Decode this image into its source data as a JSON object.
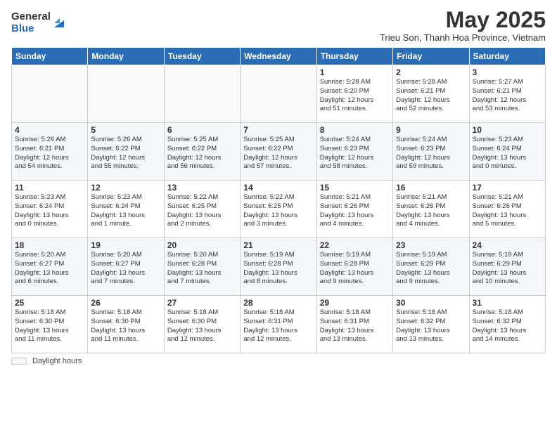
{
  "logo": {
    "general": "General",
    "blue": "Blue"
  },
  "title": "May 2025",
  "location": "Trieu Son, Thanh Hoa Province, Vietnam",
  "headers": [
    "Sunday",
    "Monday",
    "Tuesday",
    "Wednesday",
    "Thursday",
    "Friday",
    "Saturday"
  ],
  "weeks": [
    [
      {
        "day": "",
        "info": ""
      },
      {
        "day": "",
        "info": ""
      },
      {
        "day": "",
        "info": ""
      },
      {
        "day": "",
        "info": ""
      },
      {
        "day": "1",
        "info": "Sunrise: 5:28 AM\nSunset: 6:20 PM\nDaylight: 12 hours\nand 51 minutes."
      },
      {
        "day": "2",
        "info": "Sunrise: 5:28 AM\nSunset: 6:21 PM\nDaylight: 12 hours\nand 52 minutes."
      },
      {
        "day": "3",
        "info": "Sunrise: 5:27 AM\nSunset: 6:21 PM\nDaylight: 12 hours\nand 53 minutes."
      }
    ],
    [
      {
        "day": "4",
        "info": "Sunrise: 5:26 AM\nSunset: 6:21 PM\nDaylight: 12 hours\nand 54 minutes."
      },
      {
        "day": "5",
        "info": "Sunrise: 5:26 AM\nSunset: 6:22 PM\nDaylight: 12 hours\nand 55 minutes."
      },
      {
        "day": "6",
        "info": "Sunrise: 5:25 AM\nSunset: 6:22 PM\nDaylight: 12 hours\nand 56 minutes."
      },
      {
        "day": "7",
        "info": "Sunrise: 5:25 AM\nSunset: 6:22 PM\nDaylight: 12 hours\nand 57 minutes."
      },
      {
        "day": "8",
        "info": "Sunrise: 5:24 AM\nSunset: 6:23 PM\nDaylight: 12 hours\nand 58 minutes."
      },
      {
        "day": "9",
        "info": "Sunrise: 5:24 AM\nSunset: 6:23 PM\nDaylight: 12 hours\nand 59 minutes."
      },
      {
        "day": "10",
        "info": "Sunrise: 5:23 AM\nSunset: 6:24 PM\nDaylight: 13 hours\nand 0 minutes."
      }
    ],
    [
      {
        "day": "11",
        "info": "Sunrise: 5:23 AM\nSunset: 6:24 PM\nDaylight: 13 hours\nand 0 minutes."
      },
      {
        "day": "12",
        "info": "Sunrise: 5:23 AM\nSunset: 6:24 PM\nDaylight: 13 hours\nand 1 minute."
      },
      {
        "day": "13",
        "info": "Sunrise: 5:22 AM\nSunset: 6:25 PM\nDaylight: 13 hours\nand 2 minutes."
      },
      {
        "day": "14",
        "info": "Sunrise: 5:22 AM\nSunset: 6:25 PM\nDaylight: 13 hours\nand 3 minutes."
      },
      {
        "day": "15",
        "info": "Sunrise: 5:21 AM\nSunset: 6:26 PM\nDaylight: 13 hours\nand 4 minutes."
      },
      {
        "day": "16",
        "info": "Sunrise: 5:21 AM\nSunset: 6:26 PM\nDaylight: 13 hours\nand 4 minutes."
      },
      {
        "day": "17",
        "info": "Sunrise: 5:21 AM\nSunset: 6:26 PM\nDaylight: 13 hours\nand 5 minutes."
      }
    ],
    [
      {
        "day": "18",
        "info": "Sunrise: 5:20 AM\nSunset: 6:27 PM\nDaylight: 13 hours\nand 6 minutes."
      },
      {
        "day": "19",
        "info": "Sunrise: 5:20 AM\nSunset: 6:27 PM\nDaylight: 13 hours\nand 7 minutes."
      },
      {
        "day": "20",
        "info": "Sunrise: 5:20 AM\nSunset: 6:28 PM\nDaylight: 13 hours\nand 7 minutes."
      },
      {
        "day": "21",
        "info": "Sunrise: 5:19 AM\nSunset: 6:28 PM\nDaylight: 13 hours\nand 8 minutes."
      },
      {
        "day": "22",
        "info": "Sunrise: 5:19 AM\nSunset: 6:28 PM\nDaylight: 13 hours\nand 9 minutes."
      },
      {
        "day": "23",
        "info": "Sunrise: 5:19 AM\nSunset: 6:29 PM\nDaylight: 13 hours\nand 9 minutes."
      },
      {
        "day": "24",
        "info": "Sunrise: 5:19 AM\nSunset: 6:29 PM\nDaylight: 13 hours\nand 10 minutes."
      }
    ],
    [
      {
        "day": "25",
        "info": "Sunrise: 5:18 AM\nSunset: 6:30 PM\nDaylight: 13 hours\nand 11 minutes."
      },
      {
        "day": "26",
        "info": "Sunrise: 5:18 AM\nSunset: 6:30 PM\nDaylight: 13 hours\nand 11 minutes."
      },
      {
        "day": "27",
        "info": "Sunrise: 5:18 AM\nSunset: 6:30 PM\nDaylight: 13 hours\nand 12 minutes."
      },
      {
        "day": "28",
        "info": "Sunrise: 5:18 AM\nSunset: 6:31 PM\nDaylight: 13 hours\nand 12 minutes."
      },
      {
        "day": "29",
        "info": "Sunrise: 5:18 AM\nSunset: 6:31 PM\nDaylight: 13 hours\nand 13 minutes."
      },
      {
        "day": "30",
        "info": "Sunrise: 5:18 AM\nSunset: 6:32 PM\nDaylight: 13 hours\nand 13 minutes."
      },
      {
        "day": "31",
        "info": "Sunrise: 5:18 AM\nSunset: 6:32 PM\nDaylight: 13 hours\nand 14 minutes."
      }
    ]
  ],
  "footer": {
    "legend_label": "Daylight hours"
  }
}
